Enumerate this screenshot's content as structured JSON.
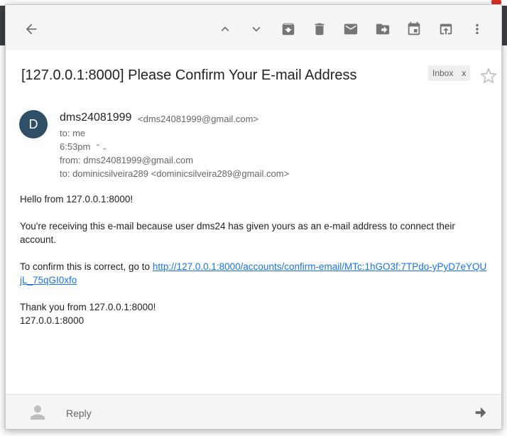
{
  "toolbar": {
    "back_icon": "arrow-back-icon",
    "items": [
      "chevron-up-icon",
      "chevron-down-icon",
      "archive-icon",
      "trash-icon",
      "mail-icon",
      "move-to-icon",
      "snooze-icon",
      "open-in-new-icon",
      "more-vert-icon"
    ]
  },
  "email": {
    "subject": "[127.0.0.1:8000] Please Confirm Your E-mail Address",
    "label": "Inbox",
    "label_close": "x",
    "avatar_letter": "D",
    "sender_name": "dms24081999",
    "sender_email": "<dms24081999@gmail.com>",
    "to_short": "to: me",
    "time": "6:53pm",
    "time_toggle": "⌃⌄",
    "from_line": "from: dms24081999@gmail.com",
    "to_line": "to: dominicsilveira289 <dominicsilveira289@gmail.com>",
    "body": {
      "greeting": "Hello from 127.0.0.1:8000!",
      "para1": "You're receiving this e-mail because user dms24 has given yours as an e-mail address to connect their account.",
      "confirm_prefix": "To confirm this is correct, go to ",
      "confirm_link": "http://127.0.0.1:8000/accounts/confirm-email/MTc:1hGO3f:7TPdo-yPyD7eYQUjL_75qGI0xfo",
      "thanks": "Thank you from 127.0.0.1:8000!",
      "signature": "127.0.0.1:8000"
    }
  },
  "reply": {
    "placeholder": "Reply"
  },
  "colors": {
    "toolbar_bg": "#f5f5f5",
    "icon_gray": "#757575",
    "avatar_bg": "#2f4f67",
    "link": "#1a73e8"
  }
}
